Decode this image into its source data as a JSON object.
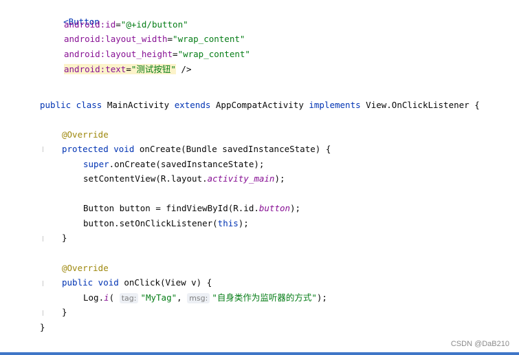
{
  "xml": {
    "open_tag": "<Button",
    "attrs": [
      {
        "name": "android:id",
        "eq": "=",
        "value": "\"@+id/button\""
      },
      {
        "name": "android:layout_width",
        "eq": "=",
        "value": "\"wrap_content\""
      },
      {
        "name": "android:layout_height",
        "eq": "=",
        "value": "\"wrap_content\""
      }
    ],
    "last_attr": {
      "name": "android:text",
      "eq": "=",
      "value": "\"测试按钮\"",
      "close": " />"
    }
  },
  "java": {
    "class_line": {
      "kw1": "public class ",
      "name": "MainActivity ",
      "kw2": "extends ",
      "parent": "AppCompatActivity ",
      "kw3": "implements ",
      "iface": "View.OnClickListener {"
    },
    "override1": "@Override",
    "oncreate_sig": {
      "kw": "protected void ",
      "rest": "onCreate(Bundle savedInstanceState) {"
    },
    "super_line": {
      "kw": "super",
      "rest": ".onCreate(savedInstanceState);"
    },
    "setcontent": {
      "pre": "setContentView(R.layout.",
      "it": "activity_main",
      "post": ");"
    },
    "button_line": {
      "pre": "Button button = findViewById(R.id.",
      "it": "button",
      "post": ");"
    },
    "listener_line": {
      "pre": "button.setOnClickListener(",
      "kw": "this",
      "post": ");"
    },
    "close1": "}",
    "override2": "@Override",
    "onclick_sig": {
      "kw": "public void ",
      "rest": "onClick(View v) {"
    },
    "log_line": {
      "pre": "Log.",
      "method": "i",
      "paren": "(",
      "hint1": "tag:",
      "arg1": "\"MyTag\"",
      "comma": ", ",
      "hint2": "msg:",
      "arg2": "\"自身类作为监听器的方式\"",
      "post": ");"
    },
    "close2": "}",
    "close3": "}"
  },
  "watermark": "CSDN @DaB210",
  "colors": {
    "keyword": "#0033b3",
    "attribute": "#871094",
    "string": "#067d17",
    "annotation": "#9e880d",
    "bottom_bar": "#3f76c7"
  }
}
